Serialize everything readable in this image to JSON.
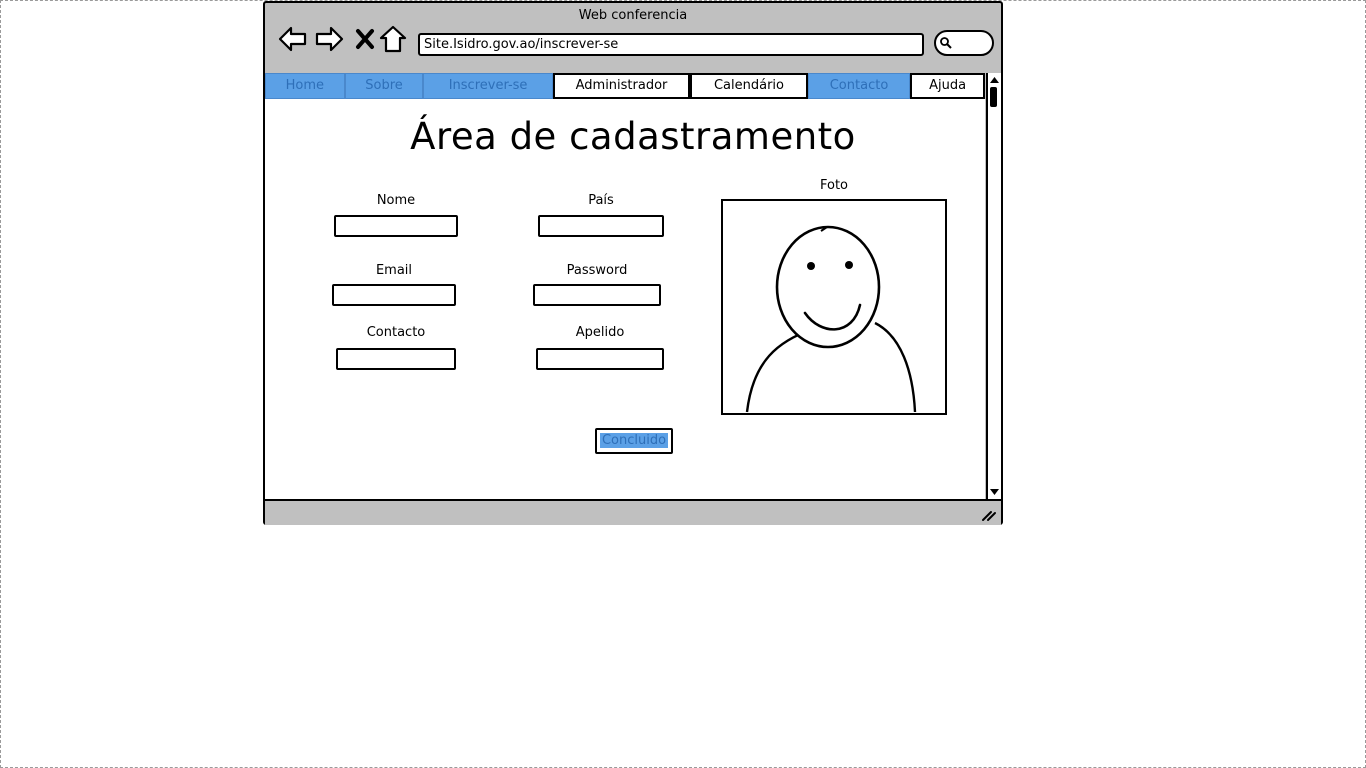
{
  "window": {
    "title": "Web conferencia"
  },
  "toolbar": {
    "url": "Site.Isidro.gov.ao/inscrever-se"
  },
  "menu": [
    {
      "label": "Home",
      "selected": true
    },
    {
      "label": "Sobre",
      "selected": true
    },
    {
      "label": "Inscrever-se",
      "selected": true
    },
    {
      "label": "Administrador",
      "selected": false
    },
    {
      "label": "Calendário",
      "selected": false
    },
    {
      "label": "Contacto",
      "selected": true
    },
    {
      "label": "Ajuda",
      "selected": false
    }
  ],
  "page": {
    "heading": "Área de cadastramento",
    "photo_label": "Foto",
    "fields": {
      "nome": {
        "label": "Nome",
        "value": ""
      },
      "pais": {
        "label": "País",
        "value": ""
      },
      "email": {
        "label": "Email",
        "value": ""
      },
      "password": {
        "label": "Password",
        "value": ""
      },
      "contacto": {
        "label": "Contacto",
        "value": ""
      },
      "apelido": {
        "label": "Apelido",
        "value": ""
      }
    },
    "submit_label": "Concluido"
  },
  "colors": {
    "selected_tab": "#5ba0e6",
    "selected_text": "#2e6fb8",
    "chrome": "#c0c0c0"
  }
}
